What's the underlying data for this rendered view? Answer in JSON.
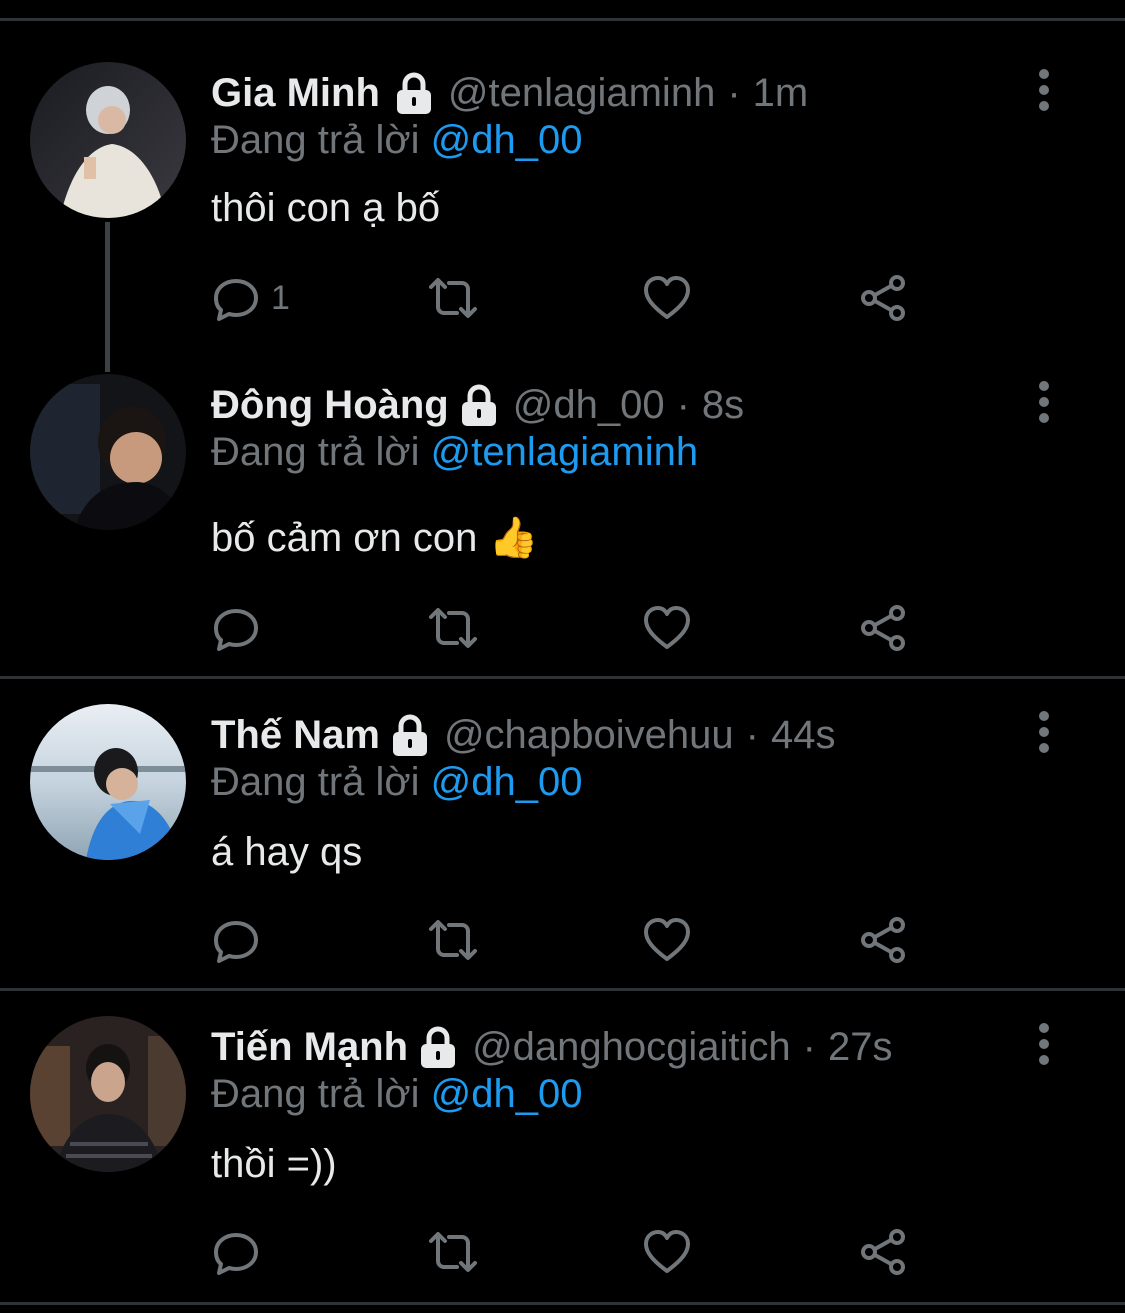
{
  "tweets": [
    {
      "name": "Gia Minh",
      "handle": "@tenlagiaminh",
      "separator": "·",
      "time": "1m",
      "replying_prefix": "Đang trả lời",
      "replying_to": "@dh_00",
      "text": "thôi con ạ bố",
      "reply_count": "1"
    },
    {
      "name": "Đông Hoàng",
      "handle": "@dh_00",
      "separator": "·",
      "time": "8s",
      "replying_prefix": "Đang trả lời",
      "replying_to": "@tenlagiaminh",
      "text": "bố cảm ơn con",
      "text_emoji": "👍",
      "reply_count": ""
    },
    {
      "name": "Thế Nam",
      "handle": "@chapboivehuu",
      "separator": "·",
      "time": "44s",
      "replying_prefix": "Đang trả lời",
      "replying_to": "@dh_00",
      "text": "á hay qs",
      "reply_count": ""
    },
    {
      "name": "Tiến Mạnh",
      "handle": "@danghocgiaitich",
      "separator": "·",
      "time": "27s",
      "replying_prefix": "Đang trả lời",
      "replying_to": "@dh_00",
      "text": "thồi =))",
      "reply_count": ""
    }
  ],
  "icons": {
    "lock": "lock-icon",
    "more": "more-options-icon",
    "reply": "reply-icon",
    "retweet": "retweet-icon",
    "like": "heart-icon",
    "share": "share-icon"
  },
  "colors": {
    "background": "#000000",
    "text_primary": "#e7e9ea",
    "text_secondary": "#71767b",
    "mention": "#1d9bf0",
    "divider": "#2f3336"
  }
}
